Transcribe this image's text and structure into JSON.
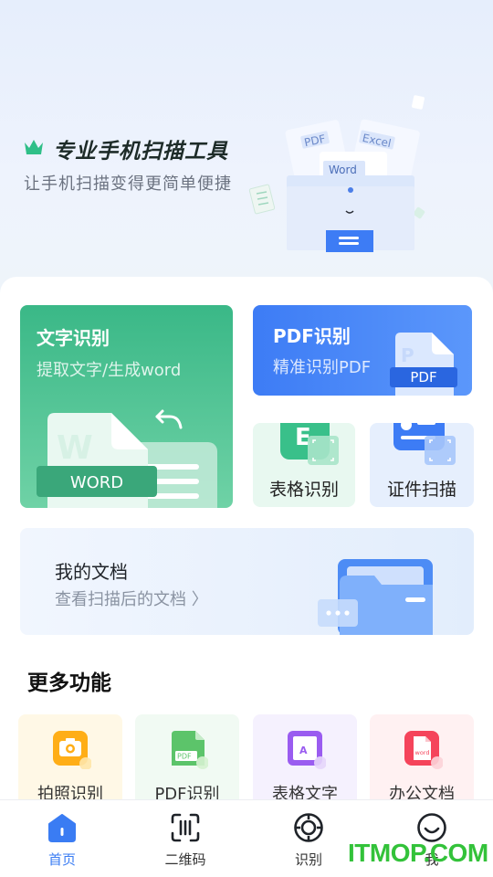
{
  "hero": {
    "title": "专业手机扫描工具",
    "subtitle": "让手机扫描变得更简单便捷",
    "illustration_tags": [
      "PDF",
      "Excel",
      "Word"
    ]
  },
  "cards": {
    "text_recognition": {
      "title": "文字识别",
      "subtitle": "提取文字/生成word",
      "badge": "WORD"
    },
    "pdf_recognition": {
      "title": "PDF识别",
      "subtitle": "精准识别PDF",
      "badge": "PDF"
    },
    "table_recognition": {
      "title": "表格识别",
      "icon_letter": "E"
    },
    "certificate_scan": {
      "title": "证件扫描"
    }
  },
  "my_documents": {
    "title": "我的文档",
    "subtitle": "查看扫描后的文档 〉"
  },
  "more_functions": {
    "title": "更多功能",
    "items": [
      {
        "label": "拍照识别",
        "icon": "camera-icon"
      },
      {
        "label": "PDF识别",
        "icon": "pdf-file-icon",
        "icon_text": "PDF"
      },
      {
        "label": "表格文字",
        "icon": "text-image-icon",
        "icon_text": "A"
      },
      {
        "label": "办公文档",
        "icon": "word-file-icon",
        "icon_text": "word"
      }
    ]
  },
  "nav": {
    "items": [
      {
        "label": "首页",
        "icon": "home-icon",
        "active": true
      },
      {
        "label": "二维码",
        "icon": "qr-scan-icon",
        "active": false
      },
      {
        "label": "识别",
        "icon": "target-icon",
        "active": false
      },
      {
        "label": "我",
        "icon": "smile-icon",
        "active": false
      }
    ]
  },
  "watermark": "ITMOP.COM",
  "colors": {
    "green_card": "#3ab887",
    "blue_card": "#3d7cf5",
    "accent_blue": "#3a7cf3",
    "watermark_green": "#33c23a"
  }
}
